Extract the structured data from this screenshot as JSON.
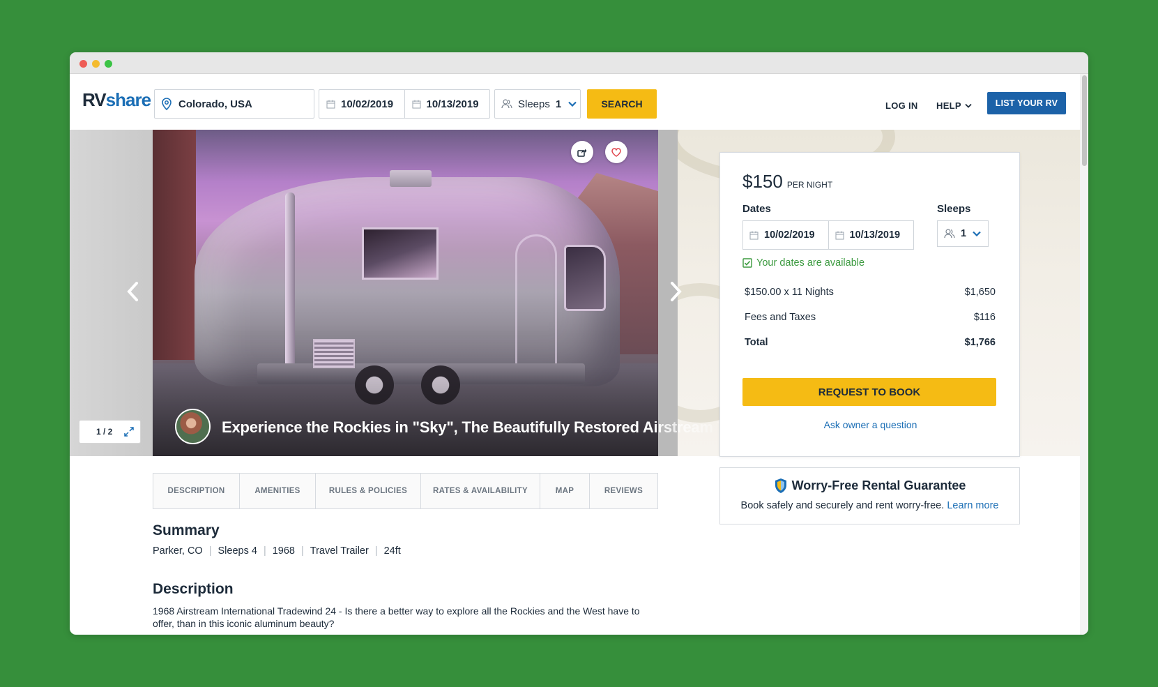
{
  "header": {
    "logo_rv": "RV",
    "logo_share": "share",
    "location": "Colorado, USA",
    "start_date": "10/02/2019",
    "end_date": "10/13/2019",
    "sleeps_label": "Sleeps",
    "sleeps_value": "1",
    "search_label": "SEARCH",
    "login_label": "LOG IN",
    "help_label": "HELP",
    "list_rv_label": "LIST YOUR RV"
  },
  "gallery": {
    "counter": "1 / 2",
    "title": "Experience the Rockies in \"Sky\", The Beautifully Restored Airstream Time-Ca"
  },
  "booking": {
    "price": "$150",
    "per_night": "PER NIGHT",
    "dates_label": "Dates",
    "sleeps_label": "Sleeps",
    "start_date": "10/02/2019",
    "end_date": "10/13/2019",
    "sleeps_value": "1",
    "availability": "Your dates are available",
    "line_items": [
      {
        "label": "$150.00 x 11 Nights",
        "amount": "$1,650"
      },
      {
        "label": "Fees and Taxes",
        "amount": "$116"
      },
      {
        "label": "Total",
        "amount": "$1,766"
      }
    ],
    "request_label": "REQUEST TO BOOK",
    "ask_label": "Ask owner a question"
  },
  "guarantee": {
    "title": "Worry-Free Rental Guarantee",
    "text": "Book safely and securely and rent worry-free.",
    "link": "Learn more"
  },
  "tabs": [
    "DESCRIPTION",
    "AMENITIES",
    "RULES & POLICIES",
    "RATES & AVAILABILITY",
    "MAP",
    "REVIEWS"
  ],
  "summary": {
    "title": "Summary",
    "items": [
      "Parker, CO",
      "Sleeps 4",
      "1968",
      "Travel Trailer",
      "24ft"
    ]
  },
  "description": {
    "title": "Description",
    "text": "1968 Airstream International Tradewind 24 - Is there a better way to explore all the Rockies and the West have to offer, than in this iconic aluminum beauty?"
  },
  "colors": {
    "accent_yellow": "#f5bb14",
    "brand_blue": "#1b6eb5",
    "available_green": "#3b9a3f"
  }
}
